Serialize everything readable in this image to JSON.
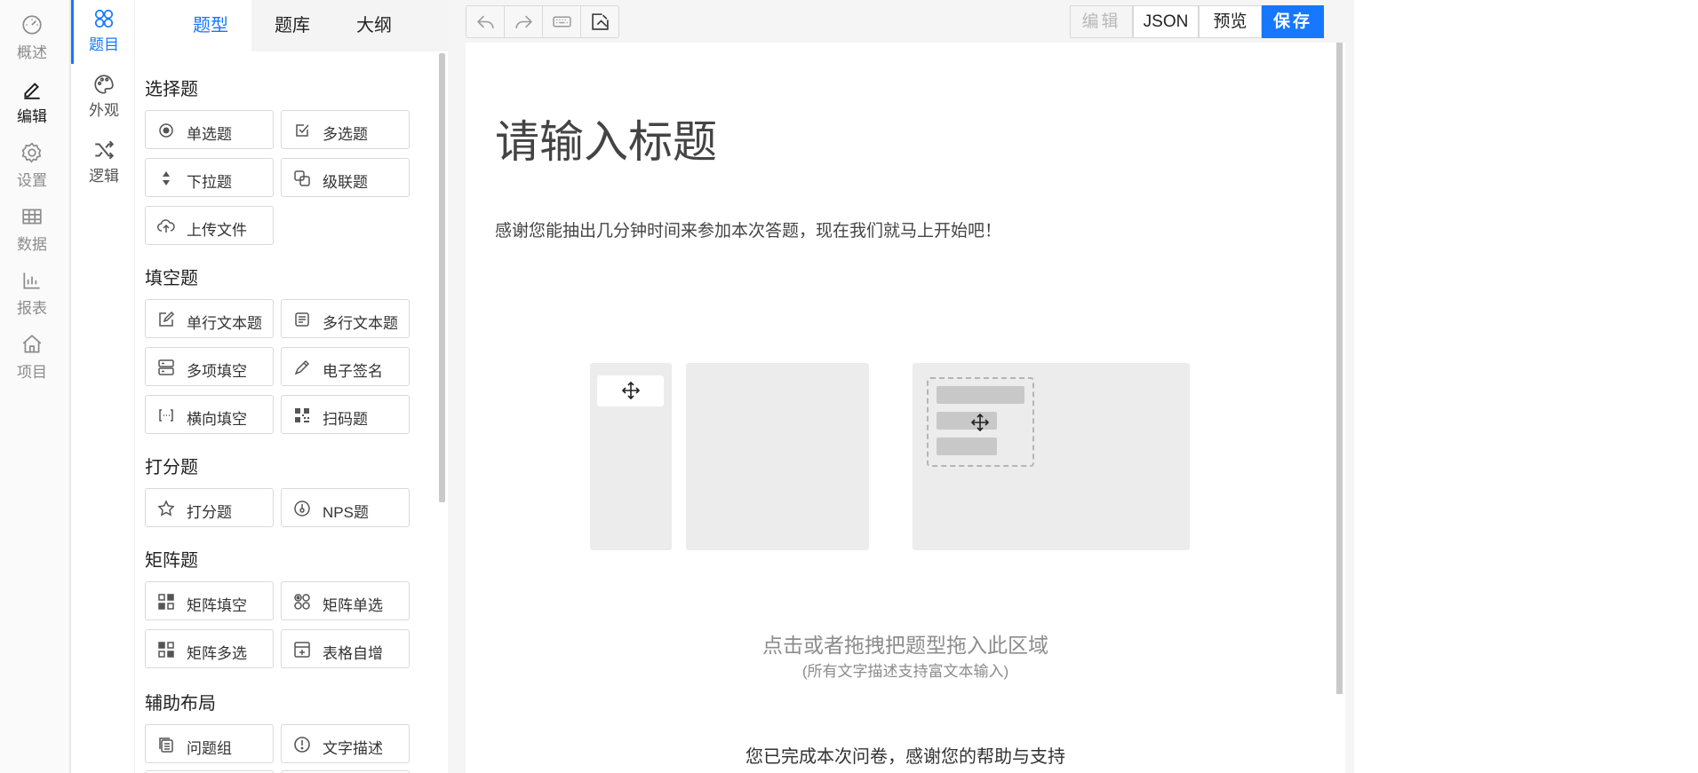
{
  "nav": {
    "items": [
      {
        "label": "概述",
        "icon": "dashboard-icon"
      },
      {
        "label": "编辑",
        "icon": "pen-icon"
      },
      {
        "label": "设置",
        "icon": "gear-icon"
      },
      {
        "label": "数据",
        "icon": "table-icon"
      },
      {
        "label": "报表",
        "icon": "bar-chart-icon"
      },
      {
        "label": "项目",
        "icon": "home-icon"
      }
    ]
  },
  "subnav": {
    "items": [
      {
        "label": "题目",
        "icon": "grid-circles-icon"
      },
      {
        "label": "外观",
        "icon": "palette-icon"
      },
      {
        "label": "逻辑",
        "icon": "shuffle-icon"
      }
    ]
  },
  "panel": {
    "tabs": [
      "题型",
      "题库",
      "大纲"
    ],
    "groups": [
      {
        "title": "选择题",
        "items": [
          "单选题",
          "多选题",
          "下拉题",
          "级联题",
          "上传文件"
        ]
      },
      {
        "title": "填空题",
        "items": [
          "单行文本题",
          "多行文本题",
          "多项填空",
          "电子签名",
          "横向填空",
          "扫码题"
        ]
      },
      {
        "title": "打分题",
        "items": [
          "打分题",
          "NPS题"
        ]
      },
      {
        "title": "矩阵题",
        "items": [
          "矩阵填空",
          "矩阵单选",
          "矩阵多选",
          "表格自增"
        ]
      },
      {
        "title": "辅助布局",
        "items": [
          "问题组",
          "文字描述"
        ]
      }
    ]
  },
  "toolbar": {
    "undo_icon": "undo-icon",
    "redo_icon": "redo-icon",
    "keyboard_icon": "keyboard-icon",
    "clear_icon": "clear-icon",
    "edit_label": "编辑",
    "json_label": "JSON",
    "preview_label": "预览",
    "save_label": "保存"
  },
  "survey": {
    "title": "请输入标题",
    "description": "感谢您能抽出几分钟时间来参加本次答题，现在我们就马上开始吧！",
    "drop_hint": "点击或者拖拽把题型拖入此区域",
    "drop_sub": "(所有文字描述支持富文本输入)",
    "end_text": "您已完成本次问卷，感谢您的帮助与支持"
  },
  "colors": {
    "accent": "#1677ff",
    "muted": "#8c8c8c"
  }
}
